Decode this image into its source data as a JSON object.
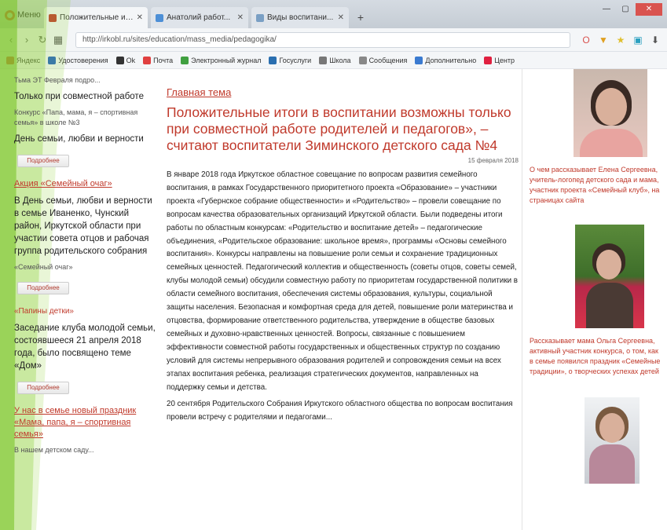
{
  "browser": {
    "opera_label": "Меню",
    "tabs": [
      {
        "label": "Положительные итоги"
      },
      {
        "label": "Анатолий работ..."
      },
      {
        "label": "Виды воспитани..."
      }
    ],
    "url": "http://irkobl.ru/sites/education/mass_media/pedagogika/",
    "bookmarks": [
      "Яндекс",
      "Удостоверения",
      "Ok",
      "Почта",
      "Электронный журнал",
      "Госуслуги",
      "Школа",
      "Сообщения",
      "Дополнительно",
      "Центр"
    ]
  },
  "left": {
    "intro_line": "Тьма ЭТ Февраля подро...",
    "intro_title": "Только при совместной работе",
    "intro_small": "Конкурс «Папа, мама, я – спортивная семья» в школе №3",
    "intro_text": "День семьи, любви и верности",
    "more_label": "Подробнее",
    "link1": "Акция «Семейный очаг»",
    "text2": "В День семьи, любви и верности в семье Иваненко, Чунский район, Иркутской области при участии совета отцов и рабочая группа родительского собрания",
    "small2": "«Семейный очаг»",
    "more_label2": "Подробнее",
    "quote1": "«Папины детки»",
    "text3": "Заседание клуба молодой семьи, состоявшееся 21 апреля 2018 года, было посвящено теме «Дом»",
    "more_label3": "Подробнее",
    "link2": "У нас в семье новый праздник «Мама, папа, я – спортивная семья»",
    "text4": "В нашем детском саду..."
  },
  "main": {
    "section_label": "Главная тема",
    "headline": "Положительные итоги в воспитании возможны только при совместной работе родителей и педагогов», – считают воспитатели Зиминского детского сада №4",
    "date": "15 февраля 2018",
    "para1": "В январе 2018 года Иркутское областное совещание по вопросам развития семейного воспитания, в рамках Государственного приоритетного проекта «Образование» – участники проекта «Губернское собрание общественности» и «Родительство» – провели совещание по вопросам качества образовательных организаций Иркутской области. Были подведены итоги работы по областным конкурсам: «Родительство и воспитание детей» – педагогические объединения, «Родительское образование: школьное время», программы «Основы семейного воспитания». Конкурсы направлены на повышение роли семьи и сохранение традиционных семейных ценностей. Педагогический коллектив и общественность (советы отцов, советы семей, клубы молодой семьи) обсудили совместную работу по приоритетам государственной политики в области семейного воспитания, обеспечения системы образования, культуры, социальной защиты населения. Безопасная и комфортная среда для детей, повышение роли материнства и отцовства, формирование ответственного родительства, утверждение в обществе базовых семейных и духовно-нравственных ценностей. Вопросы, связанные с повышением эффективности совместной работы государственных и общественных структур по созданию условий для системы непрерывного образования родителей и сопровождения семьи на всех этапах воспитания ребенка, реализация стратегических документов, направленных на поддержку семьи и детства.",
    "para2": "20 сентября Родительского Собрания Иркутского областного общества по вопросам воспитания провели встречу с родителями и педагогами..."
  },
  "right": {
    "caption1": "О чем рассказывает Елена Сергеевна, учитель-логопед детского сада и мама, участник проекта «Семейный клуб», на страницах сайта",
    "caption2": "Рассказывает мама Ольга Сергеевна, активный участник конкурса, о том, как в семье появился праздник «Семейные традиции», о творческих успехах детей"
  }
}
